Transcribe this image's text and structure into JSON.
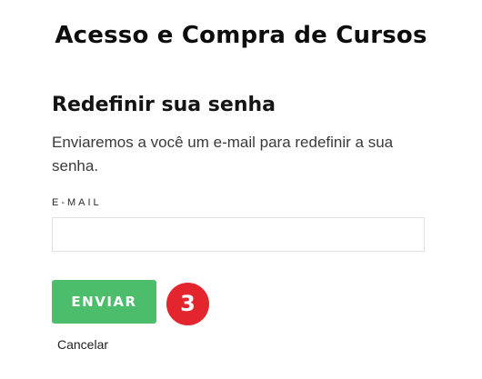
{
  "header": {
    "title": "Acesso e Compra de Cursos"
  },
  "form": {
    "heading": "Redefinir sua senha",
    "description": "Enviaremos a você um e-mail para redefinir a sua senha.",
    "email_label": "E-MAIL",
    "email_value": "",
    "email_placeholder": "",
    "submit_label": "ENVIAR",
    "cancel_label": "Cancelar"
  },
  "annotation": {
    "step_number": "3",
    "badge_color": "#e3262e"
  },
  "colors": {
    "accent": "#4cbe6b",
    "text": "#141414",
    "input_border": "#e1e1e1"
  }
}
